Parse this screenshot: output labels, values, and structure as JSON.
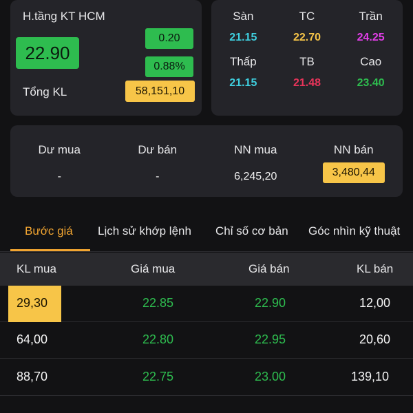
{
  "stock": {
    "name": "H.tầng KT HCM",
    "price": "22.90",
    "change_abs": "0.20",
    "change_pct": "0.88%",
    "volume_label": "Tổng KL",
    "volume": "58,151,10"
  },
  "price_range": [
    {
      "label": "Sàn",
      "value": "21.15",
      "color": "#3fd0e0"
    },
    {
      "label": "TC",
      "value": "22.70",
      "color": "#f7c548"
    },
    {
      "label": "Trần",
      "value": "24.25",
      "color": "#e23ee8"
    },
    {
      "label": "Thấp",
      "value": "21.15",
      "color": "#3fd0e0"
    },
    {
      "label": "TB",
      "value": "21.48",
      "color": "#e8345a"
    },
    {
      "label": "Cao",
      "value": "23.40",
      "color": "#2ebc4f"
    }
  ],
  "foreign": [
    {
      "label": "Dư mua",
      "value": "-"
    },
    {
      "label": "Dư bán",
      "value": "-"
    },
    {
      "label": "NN mua",
      "value": "6,245,20"
    },
    {
      "label": "NN bán",
      "value": "3,480,44"
    }
  ],
  "tabs": [
    {
      "label": "Bước giá",
      "active": true
    },
    {
      "label": "Lịch sử khớp lệnh",
      "active": false
    },
    {
      "label": "Chỉ số cơ bản",
      "active": false
    },
    {
      "label": "Góc nhìn kỹ thuật",
      "active": false
    }
  ],
  "order_book": {
    "headers": [
      "KL mua",
      "Giá mua",
      "Giá bán",
      "KL bán"
    ],
    "rows": [
      {
        "kl_mua": "29,30",
        "gia_mua": "22.85",
        "gia_ban": "22.90",
        "kl_ban": "12,00"
      },
      {
        "kl_mua": "64,00",
        "gia_mua": "22.80",
        "gia_ban": "22.95",
        "kl_ban": "20,60"
      },
      {
        "kl_mua": "88,70",
        "gia_mua": "22.75",
        "gia_ban": "23.00",
        "kl_ban": "139,10"
      }
    ]
  },
  "colors": {
    "up_green": "#2ebc4f",
    "highlight_yellow": "#f7c548",
    "active_tab": "#f2a531"
  }
}
